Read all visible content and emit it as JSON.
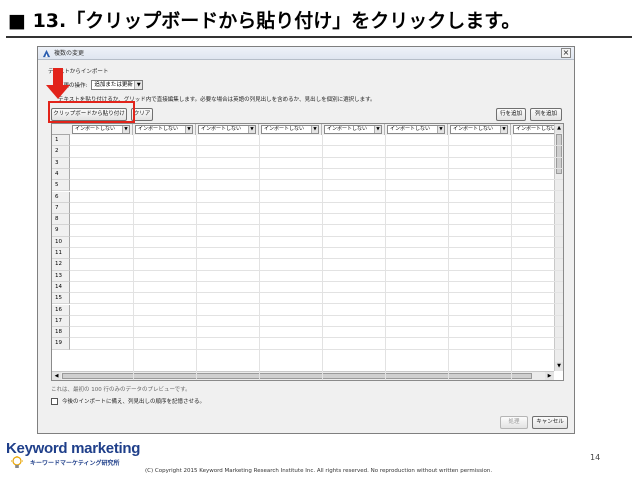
{
  "slide": {
    "title": "■ 13.「クリップボードから貼り付け」をクリックします。",
    "page_number": "14",
    "copyright": "(C) Copyright 2015 Keyword Marketing Research Institute Inc. All rights reserved. No reproduction without written permission."
  },
  "logo": {
    "text": "Keyword marketing",
    "subtitle": "キーワードマーケティング研究所"
  },
  "dialog": {
    "title": "複数の変更",
    "close_glyph": "×",
    "section_label": "テキストからインポート",
    "operation_label": "変更の操作:",
    "operation_value": "追加または更新",
    "instruction": "テキストを貼り付けるか、グリッド内で直接編集します。必要な場合は英語の列見出しを含めるか、見出しを個別に選択します。",
    "paste_button": "クリップボードから貼り付け",
    "clear_button": "クリア",
    "add_row_button": "行を追加",
    "add_col_button": "列を追加",
    "column_placeholder": "インポートしない",
    "column_count": 8,
    "rows": [
      "1",
      "2",
      "3",
      "4",
      "5",
      "6",
      "7",
      "8",
      "9",
      "10",
      "11",
      "12",
      "13",
      "14",
      "15",
      "16",
      "17",
      "18",
      "19"
    ],
    "preview_note": "これは、最初の 100 行のみのデータのプレビューです。",
    "remember_label": "今後のインポートに備え、列見出しの順序を記憶させる。",
    "import_button": "処理",
    "cancel_button": "キャンセル"
  },
  "colors": {
    "highlight": "#e2231a",
    "arrow": "#e2231a",
    "logo": "#1f3f8a"
  }
}
